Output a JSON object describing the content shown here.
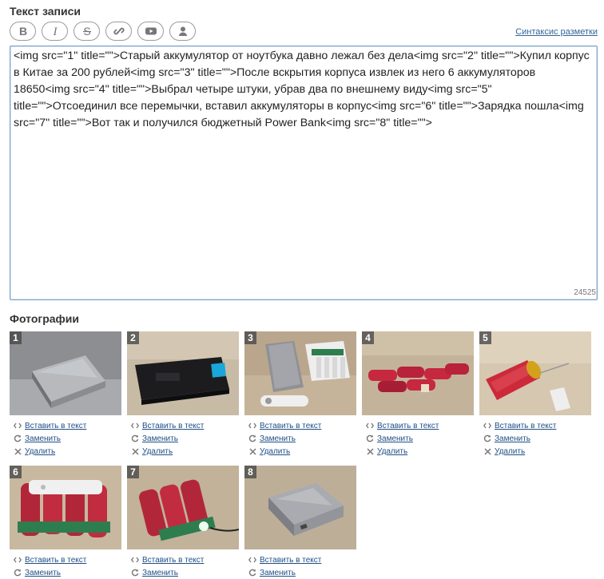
{
  "editor_section": {
    "title": "Текст записи",
    "syntax_link": "Синтаксис разметки",
    "char_counter": "24525",
    "toolbar": [
      {
        "name": "bold-button",
        "icon": "bold-icon"
      },
      {
        "name": "italic-button",
        "icon": "italic-icon"
      },
      {
        "name": "strikethrough-button",
        "icon": "strikethrough-icon"
      },
      {
        "name": "link-button",
        "icon": "link-icon"
      },
      {
        "name": "youtube-button",
        "icon": "youtube-icon"
      },
      {
        "name": "user-button",
        "icon": "user-icon"
      }
    ],
    "text": "<img src=\"1\" title=\"\">Старый аккумулятор от ноутбука давно лежал без дела<img src=\"2\" title=\"\">Купил корпус в Китае за 200 рублей<img src=\"3\" title=\"\">После вскрытия корпуса извлек из него 6 аккумуляторов 18650<img src=\"4\" title=\"\">Выбрал четыре штуки, убрав два по внешнему виду<img src=\"5\" title=\"\">Отсоединил все перемычки, вставил аккумуляторы в корпус<img src=\"6\" title=\"\">Зарядка пошла<img src=\"7\" title=\"\">Вот так и получился бюджетный Power Bank<img src=\"8\" title=\"\">"
  },
  "photos_section": {
    "title": "Фотографии",
    "actions": {
      "insert": "Вставить в текст",
      "replace": "Заменить",
      "delete": "Удалить"
    },
    "photos": [
      {
        "number": "1"
      },
      {
        "number": "2"
      },
      {
        "number": "3"
      },
      {
        "number": "4"
      },
      {
        "number": "5"
      },
      {
        "number": "6"
      },
      {
        "number": "7"
      },
      {
        "number": "8"
      }
    ]
  },
  "colors": {
    "link": "#1f4f86",
    "editor_border": "#7fa3c8",
    "number_badge": "#464646"
  }
}
